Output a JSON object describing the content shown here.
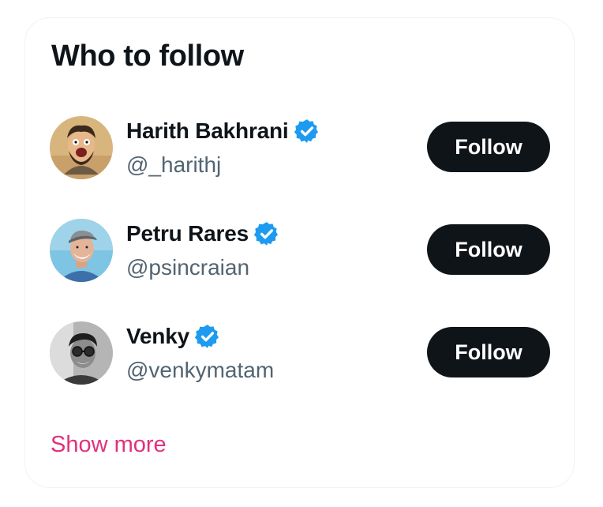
{
  "widget": {
    "title": "Who to follow",
    "show_more_label": "Show more",
    "accent_color": "#e0317d"
  },
  "suggestions": [
    {
      "name": "Harith Bakhrani",
      "handle": "@_harithj",
      "verified": true,
      "avatar_icon": "cartoon-avatar-icon",
      "follow_label": "Follow"
    },
    {
      "name": "Petru Rares",
      "handle": "@psincraian",
      "verified": true,
      "avatar_icon": "user-photo-avatar-icon",
      "follow_label": "Follow"
    },
    {
      "name": "Venky",
      "handle": "@venkymatam",
      "verified": true,
      "avatar_icon": "user-photo-avatar-icon",
      "follow_label": "Follow"
    }
  ],
  "colors": {
    "verified_badge": "#1d9bf0",
    "button_bg": "#0f1419",
    "handle_text": "#536471"
  }
}
